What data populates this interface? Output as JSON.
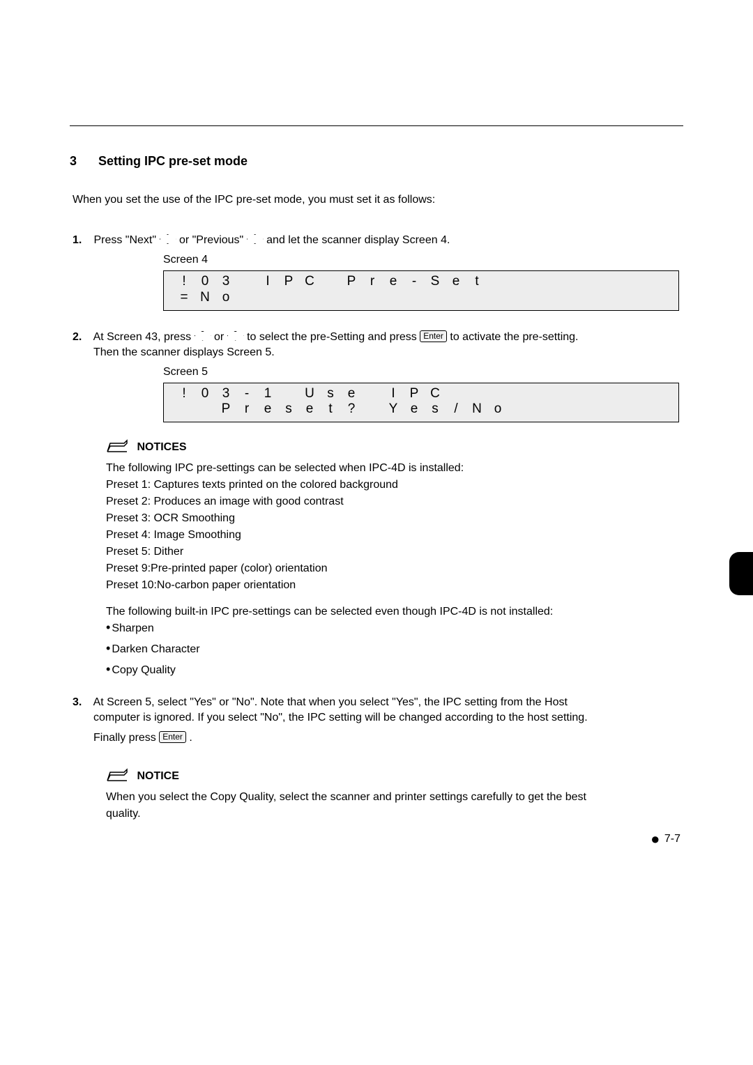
{
  "section": {
    "number": "3",
    "title": "Setting IPC pre-set mode"
  },
  "intro": "When you set the use of the IPC pre-set mode, you must set it as follows:",
  "steps": {
    "s1": {
      "num": "1.",
      "pre": "Press \"Next\" ",
      "mid": " or \"Previous\" ",
      "post": " and let the scanner display Screen 4."
    },
    "s2": {
      "num": "2.",
      "pre": "At Screen 43, press ",
      "mid": " or ",
      "afterDiamond": " to select the pre-Setting and press ",
      "post": " to activate the pre-setting.",
      "line2": "Then the scanner displays Screen 5."
    },
    "s3": {
      "num": "3.",
      "text1": "At Screen 5, select \"Yes\" or \"No\". Note that when you select \"Yes\", the IPC setting from the Host",
      "text2": "computer is ignored. If you select \"No\", the IPC setting will be changed according to the host setting.",
      "finally_pre": "Finally press ",
      "finally_post": "."
    }
  },
  "screen4": {
    "label": "Screen 4",
    "row1": [
      "!",
      "0",
      "3",
      "",
      "I",
      "P",
      "C",
      "",
      "P",
      "r",
      "e",
      "-",
      "S",
      "e",
      "t"
    ],
    "row2": [
      "=",
      "N",
      "o",
      "",
      "",
      "",
      "",
      "",
      "",
      "",
      "",
      "",
      "",
      "",
      ""
    ]
  },
  "screen5": {
    "label": "Screen 5",
    "row1": [
      "!",
      "0",
      "3",
      "-",
      "1",
      "",
      "U",
      "s",
      "e",
      "",
      "I",
      "P",
      "C",
      "",
      "",
      "",
      ""
    ],
    "row2": [
      "",
      "",
      "P",
      "r",
      "e",
      "s",
      "e",
      "t",
      "?",
      "",
      "Y",
      "e",
      "s",
      "/",
      "N",
      "o",
      ""
    ]
  },
  "notices": {
    "heading": "NOTICES",
    "l1": "The following IPC pre-settings can be selected when IPC-4D is installed:",
    "p1": "Preset 1: Captures texts printed on the colored background",
    "p2": "Preset 2: Produces an image with good contrast",
    "p3": "Preset 3: OCR Smoothing",
    "p4": "Preset 4: Image Smoothing",
    "p5": "Preset 5: Dither",
    "p9": "Preset 9:Pre-printed paper (color) orientation",
    "p10": "Preset 10:No-carbon paper orientation",
    "l2": "The following built-in IPC pre-settings can be selected even though IPC-4D is not installed:",
    "b1": "Sharpen",
    "b2": "Darken Character",
    "b3": "Copy Quality"
  },
  "notice2": {
    "heading": "NOTICE",
    "line1": "When you select the Copy Quality, select the scanner and printer settings carefully to get the best",
    "line2": "quality."
  },
  "enter_label": "Enter",
  "footer": "7-7"
}
